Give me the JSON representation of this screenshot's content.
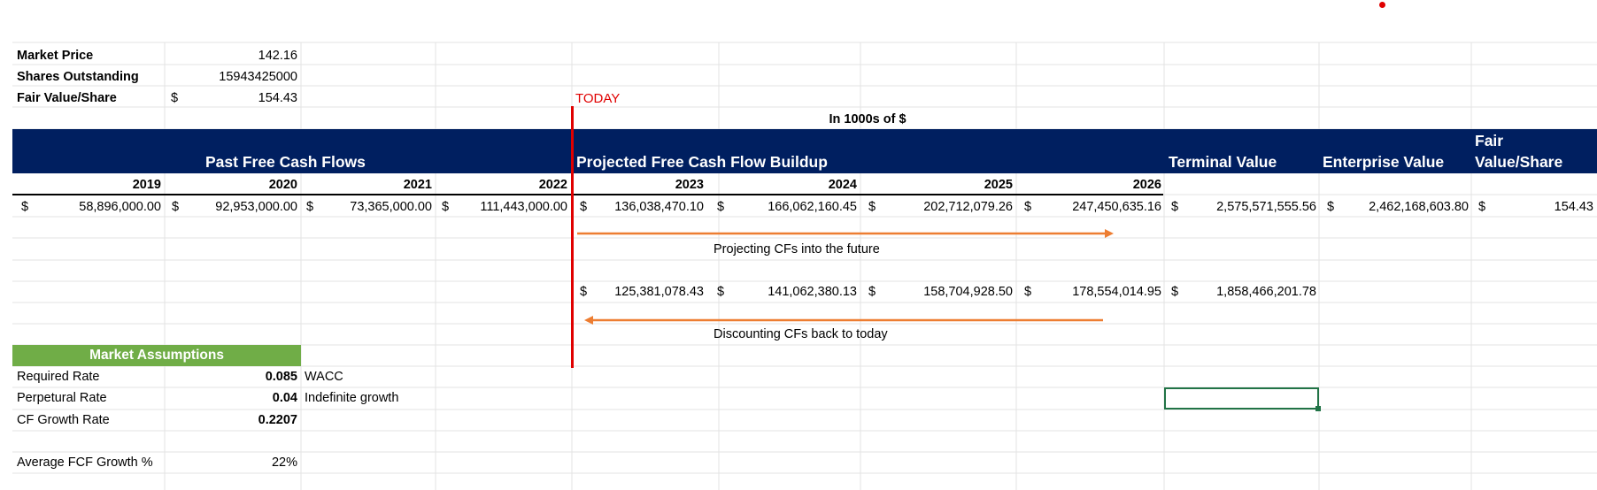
{
  "top_metrics": {
    "market_price_label": "Market Price",
    "market_price_value": "142.16",
    "shares_label": "Shares Outstanding",
    "shares_value": "15943425000",
    "fair_value_label": "Fair Value/Share",
    "fair_value_currency": "$",
    "fair_value_value": "154.43"
  },
  "today_label": "TODAY",
  "units_label": "In 1000s of $",
  "headers": {
    "past": "Past Free Cash Flows",
    "projected": "Projected Free Cash Flow Buildup",
    "terminal": "Terminal Value",
    "enterprise": "Enterprise Value",
    "fair_line1": "Fair",
    "fair_line2": "Value/Share"
  },
  "years": [
    "2019",
    "2020",
    "2021",
    "2022",
    "2023",
    "2024",
    "2025",
    "2026"
  ],
  "currency": "$",
  "cashflows": {
    "past": [
      "58,896,000.00",
      "92,953,000.00",
      "73,365,000.00",
      "111,443,000.00"
    ],
    "projected": [
      "136,038,470.10",
      "166,062,160.45",
      "202,712,079.26",
      "247,450,635.16"
    ],
    "terminal": "2,575,571,555.56",
    "enterprise": "2,462,168,603.80",
    "fair_value": "154.43"
  },
  "discounted": {
    "projected": [
      "125,381,078.43",
      "141,062,380.13",
      "158,704,928.50",
      "178,554,014.95"
    ],
    "terminal": "1,858,466,201.78"
  },
  "annotations": {
    "projecting": "Projecting CFs into the future",
    "discounting": "Discounting CFs back to today"
  },
  "assumptions": {
    "title": "Market Assumptions",
    "required_label": "Required Rate",
    "required_value": "0.085",
    "required_note": "WACC",
    "perpetual_label": "Perpetural Rate",
    "perpetual_value": "0.04",
    "perpetual_note": "Indefinite growth",
    "growth_label": "CF Growth Rate",
    "growth_value": "0.2207",
    "avg_label": "Average FCF Growth %",
    "avg_value": "22%"
  },
  "colors": {
    "header_band": "#001f60",
    "today_red": "#e00000",
    "arrow_orange": "#ed7d31",
    "assumptions_green": "#70ad47",
    "selection_green": "#217346"
  }
}
